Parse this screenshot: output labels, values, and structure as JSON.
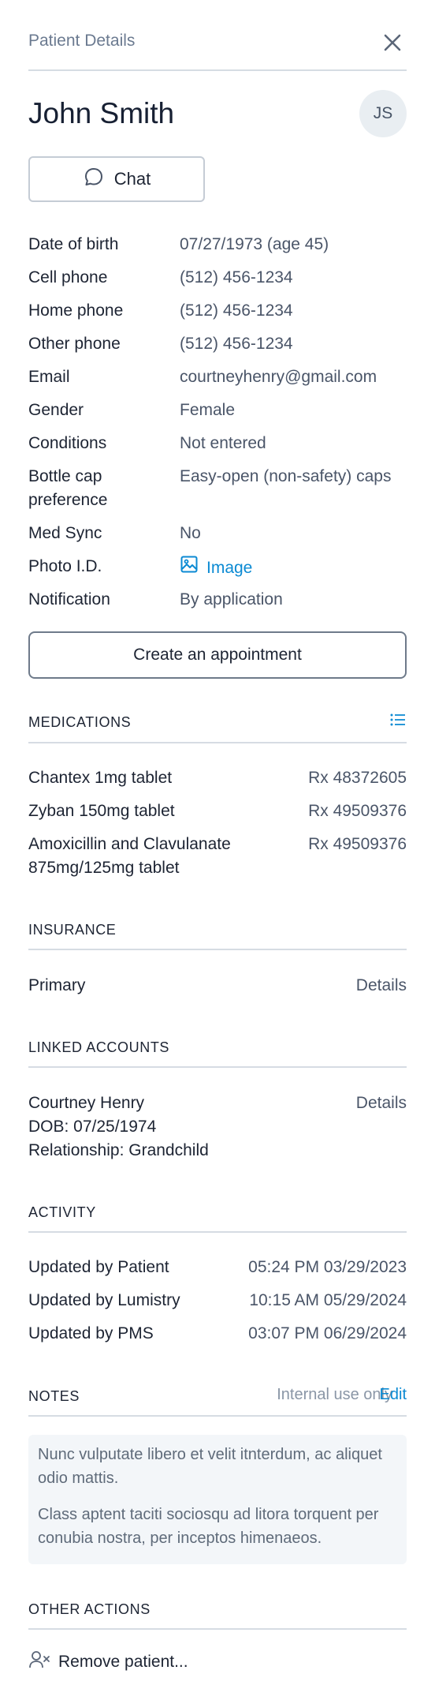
{
  "header": {
    "title": "Patient Details"
  },
  "patient": {
    "name": "John Smith",
    "initials": "JS"
  },
  "chat_label": "Chat",
  "details": {
    "dob_label": "Date of birth",
    "dob_value": "07/27/1973 (age 45)",
    "cell_label": "Cell phone",
    "cell_value": "(512) 456-1234",
    "home_label": "Home phone",
    "home_value": "(512) 456-1234",
    "other_label": "Other phone",
    "other_value": "(512) 456-1234",
    "email_label": "Email",
    "email_value": "courtneyhenry@gmail.com",
    "gender_label": "Gender",
    "gender_value": "Female",
    "conditions_label": "Conditions",
    "conditions_value": "Not entered",
    "bottlecap_label_1": "Bottle cap",
    "bottlecap_label_2": "preference",
    "bottlecap_value": "Easy-open (non-safety) caps",
    "medsync_label": "Med Sync",
    "medsync_value": "No",
    "photo_label": "Photo I.D.",
    "photo_value": "Image",
    "notification_label": "Notification",
    "notification_value": "By application"
  },
  "appointment_button": "Create an appointment",
  "medications": {
    "title": "MEDICATIONS",
    "items": [
      {
        "name": "Chantex 1mg tablet",
        "rx": "Rx 48372605"
      },
      {
        "name": "Zyban 150mg tablet",
        "rx": "Rx 49509376"
      },
      {
        "name_line1": "Amoxicillin and Clavulanate",
        "name_line2": "875mg/125mg tablet",
        "rx": "Rx 49509376"
      }
    ]
  },
  "insurance": {
    "title": "INSURANCE",
    "primary_label": "Primary",
    "details_link": "Details"
  },
  "linked_accounts": {
    "title": "LINKED ACCOUNTS",
    "name": "Courtney Henry",
    "dob": "DOB: 07/25/1974",
    "relationship": "Relationship: Grandchild",
    "details_link": "Details"
  },
  "activity": {
    "title": "ACTIVITY",
    "items": [
      {
        "label": "Updated by Patient",
        "time": "05:24 PM 03/29/2023"
      },
      {
        "label": "Updated by Lumistry",
        "time": "10:15 AM 05/29/2024"
      },
      {
        "label": "Updated by PMS",
        "time": "03:07 PM 06/29/2024"
      }
    ]
  },
  "notes": {
    "title": "NOTES",
    "internal_label": "Internal use only",
    "edit_link": "Edit",
    "paragraph1": "Nunc vulputate libero et velit itnterdum, ac aliquet odio mattis.",
    "paragraph2": "Class aptent taciti sociosqu ad litora torquent per conubia nostra, per inceptos himenaeos."
  },
  "other_actions": {
    "title": "OTHER ACTIONS",
    "remove_label": "Remove patient..."
  },
  "colors": {
    "link": "#0b8ad3",
    "muted": "#6b7a90",
    "divider": "#d6dce3",
    "notes_bg": "#f3f6f9"
  }
}
